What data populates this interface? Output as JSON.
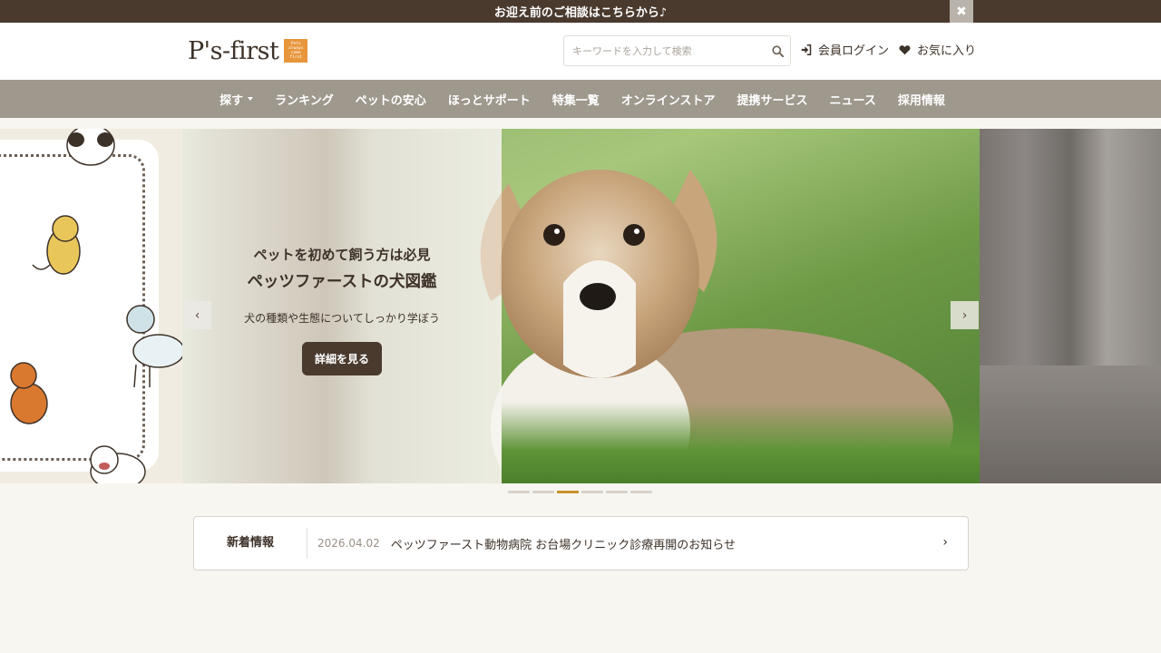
{
  "topbar": {
    "message": "お迎え前のご相談はこちらから♪",
    "close_label": "✖"
  },
  "header": {
    "logo_text": "P's-first",
    "search_placeholder": "キーワードを入力して検索",
    "login_label": "会員ログイン",
    "favorites_label": "お気に入り"
  },
  "nav": {
    "items": [
      {
        "label": "探す"
      },
      {
        "label": "ランキング"
      },
      {
        "label": "ペットの安心"
      },
      {
        "label": "ほっとサポート"
      },
      {
        "label": "特集一覧"
      },
      {
        "label": "オンラインストア"
      },
      {
        "label": "提携サービス"
      },
      {
        "label": "ニュース"
      },
      {
        "label": "採用情報"
      }
    ]
  },
  "hero": {
    "subtitle": "ペットを初めて飼う方は必見",
    "title": "ペッツファーストの犬図鑑",
    "description": "犬の種類や生態についてしっかり学ぼう",
    "button_label": "詳細を見る",
    "prev_label": "‹",
    "next_label": "›",
    "slide_count": 6,
    "active_slide": 3
  },
  "news": {
    "label": "新着情報",
    "date": "2026.04.02",
    "text": "ペッツファースト動物病院 お台場クリニック診療再開のお知らせ",
    "arrow": "›"
  },
  "colors": {
    "brand_dark": "#4a3a2e",
    "nav_bg": "#9e988d",
    "accent": "#c8922d",
    "logo_orange": "#e8963c"
  }
}
